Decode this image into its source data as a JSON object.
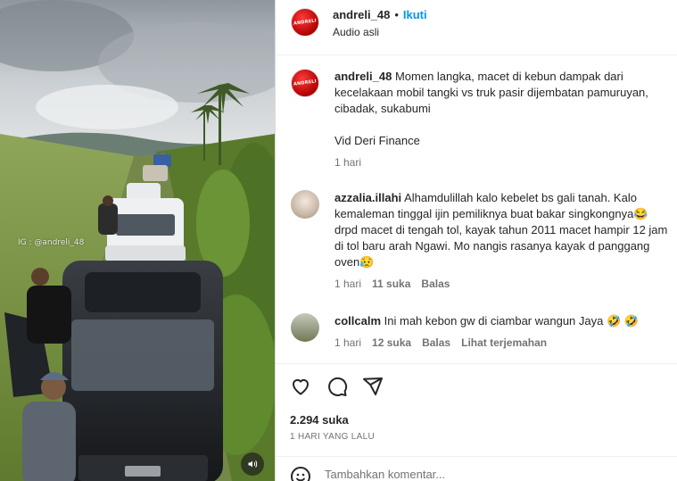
{
  "media": {
    "watermark": "IG : @andreli_48",
    "audio_icon": "speaker-icon"
  },
  "header": {
    "avatar_text": "ANDRELI",
    "username": "andreli_48",
    "separator": "•",
    "follow_label": "Ikuti",
    "audio_label": "Audio asli"
  },
  "caption": {
    "username": "andreli_48",
    "text": "Momen langka, macet di kebun dampak dari kecelakaan mobil tangki vs truk pasir dijembatan pamuruyan, cibadak, sukabumi",
    "credit": "Vid Deri Finance",
    "time": "1 hari"
  },
  "comments": [
    {
      "username": "azzalia.illahi",
      "text": "Alhamdulillah kalo kebelet bs gali tanah. Kalo kemaleman tinggal ijin pemiliknya buat bakar singkongnya😂 drpd macet di tengah tol, kayak tahun 2011 macet hampir 12 jam di tol baru arah Ngawi. Mo nangis rasanya kayak d panggang oven😥",
      "time": "1 hari",
      "likes": "11 suka",
      "reply": "Balas"
    },
    {
      "username": "collcalm",
      "text": "Ini mah kebon gw di ciambar wangun Jaya 🤣 🤣",
      "time": "1 hari",
      "likes": "12 suka",
      "reply": "Balas",
      "translate": "Lihat terjemahan"
    }
  ],
  "actions": {
    "icons": [
      "heart-icon",
      "comment-icon",
      "share-icon"
    ],
    "likes": "2.294 suka",
    "posted": "1 HARI YANG LALU"
  },
  "add_comment": {
    "placeholder": "Tambahkan komentar..."
  },
  "colors": {
    "link": "#0095f6",
    "text": "#262626",
    "muted": "#737373",
    "divider": "#efefef"
  }
}
